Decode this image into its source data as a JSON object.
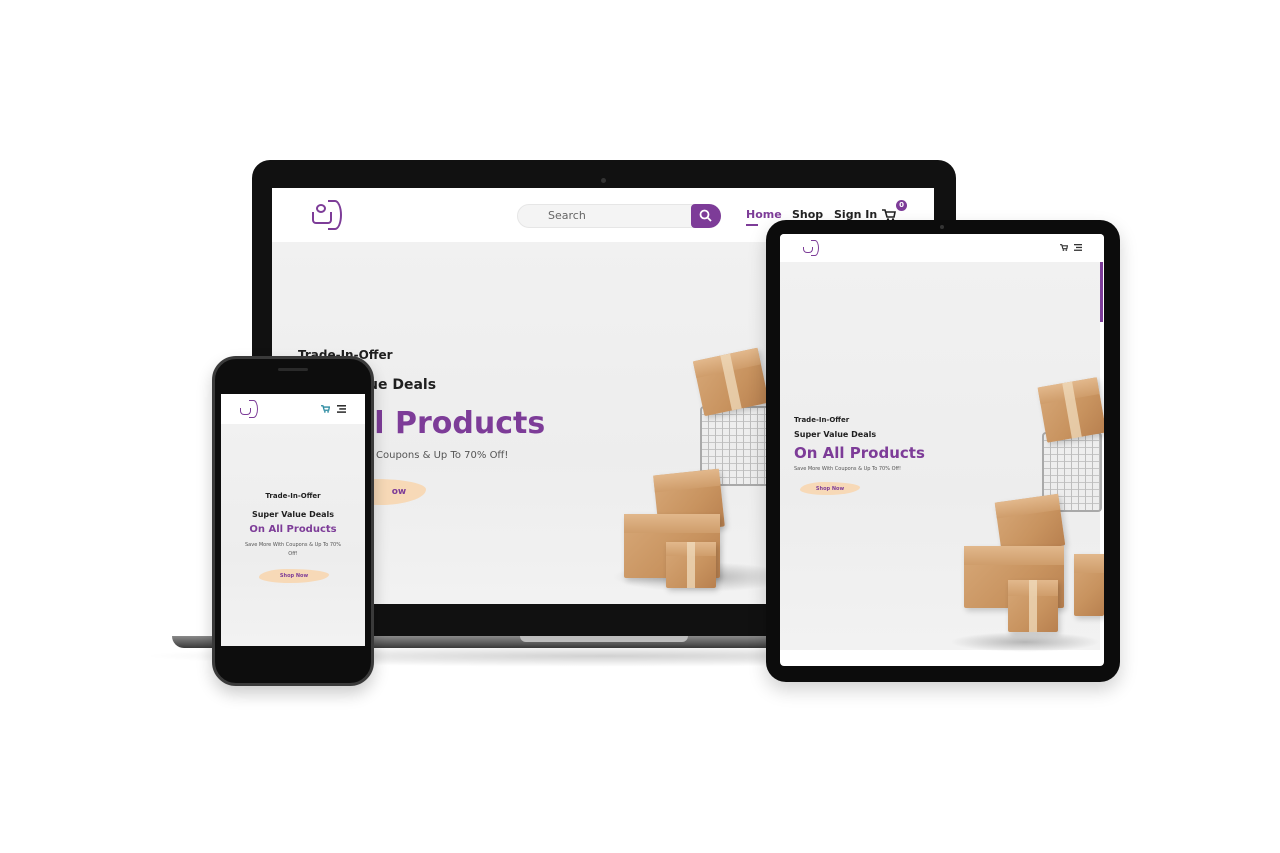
{
  "site": {
    "search_placeholder": "Search",
    "nav": [
      {
        "label": "Home",
        "active": true
      },
      {
        "label": "Shop",
        "active": false
      },
      {
        "label": "Sign In",
        "active": false
      }
    ],
    "cart_count": "0",
    "hero": {
      "kicker": "Trade-In-Offer",
      "lead": "Super Value Deals",
      "headline": "On All Products",
      "subtitle": "Save More With Coupons & Up To 70% Off!",
      "button": "Shop Now"
    }
  },
  "laptop_visible": {
    "kicker": "Trade-In-Offer",
    "lead_fragment": "ue Deals",
    "headline_fragment": "ll Products",
    "subtitle_fragment": "Coupons & Up To 70% Off!",
    "button_fragment": "ow"
  },
  "phone_visible": {
    "subtitle_line1": "Save More With Coupons & Up To 70%",
    "subtitle_line2": "Off!"
  },
  "colors": {
    "brand_purple": "#7d3c98",
    "button_peach": "#f7d9b7",
    "device_black": "#111111"
  },
  "icons": [
    "search-icon",
    "cart-icon",
    "menu-icon",
    "logo"
  ]
}
